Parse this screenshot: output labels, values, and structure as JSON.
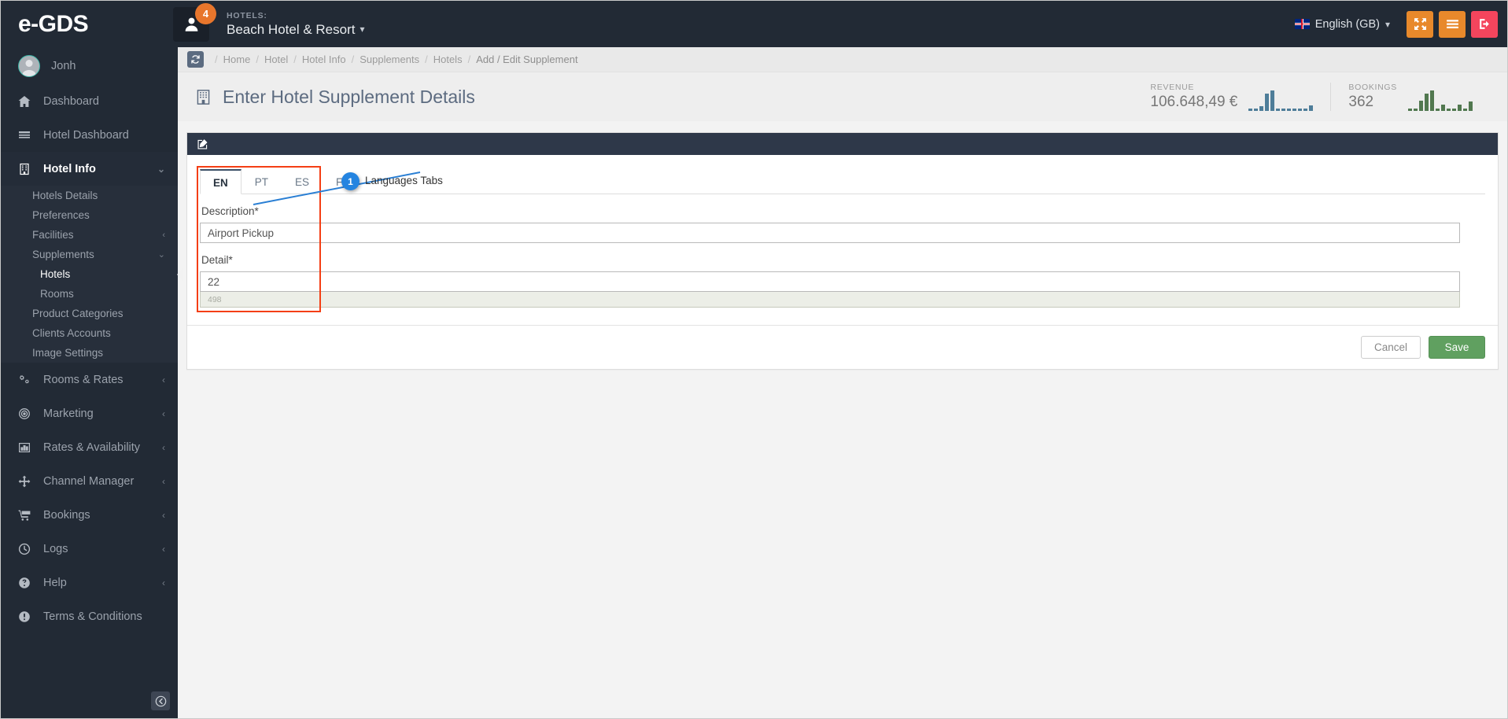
{
  "topbar": {
    "brand": "e-GDS",
    "notification_count": "4",
    "hotels_label": "HOTELS:",
    "hotel_name": "Beach Hotel & Resort",
    "caret": "⌄",
    "language": "English (GB)",
    "buttons": [
      {
        "name": "fullscreen-button",
        "glyph": "fullscreen",
        "color": "#e8892b"
      },
      {
        "name": "menu-button",
        "glyph": "menu",
        "color": "#e8892b"
      },
      {
        "name": "logout-button",
        "glyph": "logout",
        "color": "#f4455d"
      }
    ]
  },
  "sidebar": {
    "user": "Jonh",
    "items": [
      {
        "label": "Dashboard",
        "icon": "home-icon",
        "arrow": "",
        "active": false
      },
      {
        "label": "Hotel Dashboard",
        "icon": "list-icon",
        "arrow": "",
        "active": false
      },
      {
        "label": "Hotel Info",
        "icon": "building-icon",
        "arrow": "⌄",
        "active": true
      }
    ],
    "hotel_info_submenu": [
      {
        "label": "Hotels Details",
        "arrow": ""
      },
      {
        "label": "Preferences",
        "arrow": ""
      },
      {
        "label": "Facilities",
        "arrow": "‹"
      },
      {
        "label": "Supplements",
        "arrow": "⌄"
      }
    ],
    "supplements_submenu": [
      {
        "label": "Hotels",
        "current": true
      },
      {
        "label": "Rooms",
        "current": false
      }
    ],
    "hotel_info_submenu_rest": [
      {
        "label": "Product Categories",
        "arrow": ""
      },
      {
        "label": "Clients Accounts",
        "arrow": ""
      },
      {
        "label": "Image Settings",
        "arrow": ""
      }
    ],
    "items_bottom": [
      {
        "label": "Rooms & Rates",
        "icon": "gears-icon",
        "arrow": "‹"
      },
      {
        "label": "Marketing",
        "icon": "target-icon",
        "arrow": "‹"
      },
      {
        "label": "Rates & Availability",
        "icon": "bars-chart-icon",
        "arrow": "‹"
      },
      {
        "label": "Channel Manager",
        "icon": "arrows-move-icon",
        "arrow": "‹"
      },
      {
        "label": "Bookings",
        "icon": "cart-icon",
        "arrow": "‹"
      },
      {
        "label": "Logs",
        "icon": "clock-icon",
        "arrow": "‹"
      },
      {
        "label": "Help",
        "icon": "question-circle-icon",
        "arrow": "‹"
      },
      {
        "label": "Terms & Conditions",
        "icon": "exclamation-circle-icon",
        "arrow": ""
      }
    ],
    "collapse_glyph": "←"
  },
  "breadcrumb": {
    "items": [
      "Home",
      "Hotel",
      "Hotel Info",
      "Supplements",
      "Hotels",
      "Add / Edit Supplement"
    ],
    "separator": "/"
  },
  "page": {
    "title": "Enter Hotel Supplement Details"
  },
  "stats": {
    "revenue": {
      "label": "REVENUE",
      "value": "106.648,49 €",
      "color": "#4e7d99",
      "spark": [
        3,
        3,
        6,
        22,
        26,
        3,
        3,
        3,
        3,
        3,
        3,
        7
      ]
    },
    "bookings": {
      "label": "BOOKINGS",
      "value": "362",
      "color": "#51784f",
      "spark": [
        3,
        3,
        13,
        22,
        26,
        3,
        8,
        3,
        3,
        8,
        3,
        12
      ]
    }
  },
  "form": {
    "language_tabs": [
      {
        "code": "EN",
        "active": true
      },
      {
        "code": "PT",
        "active": false
      },
      {
        "code": "ES",
        "active": false
      },
      {
        "code": "FR",
        "active": false
      }
    ],
    "description_label": "Description*",
    "description_value": "Airport Pickup",
    "detail_label": "Detail*",
    "detail_value": "22",
    "detail_counter": "498",
    "cancel_label": "Cancel",
    "save_label": "Save"
  },
  "annotation": {
    "number": "1",
    "text": "Languages Tabs",
    "box_color": "#f43e14",
    "bubble_color": "#2484e0"
  }
}
